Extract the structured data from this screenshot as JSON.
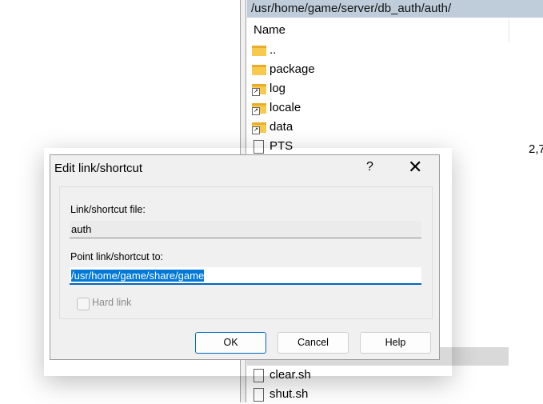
{
  "panel": {
    "path": "/usr/home/game/server/db_auth/auth/",
    "column_name": "Name",
    "items": [
      {
        "name": "..",
        "type": "parent"
      },
      {
        "name": "package",
        "type": "folder"
      },
      {
        "name": "log",
        "type": "folder-link"
      },
      {
        "name": "locale",
        "type": "folder-link"
      },
      {
        "name": "data",
        "type": "folder-link"
      },
      {
        "name": "PTS",
        "type": "file",
        "size": "2,7"
      },
      {
        "name": "clear.sh",
        "type": "file"
      },
      {
        "name": "shut.sh",
        "type": "file"
      }
    ]
  },
  "dialog": {
    "title": "Edit link/shortcut",
    "help_glyph": "?",
    "close_glyph": "✕",
    "file_label": "Link/shortcut file:",
    "file_value": "auth",
    "target_label": "Point link/shortcut to:",
    "target_value": "/usr/home/game/share/game",
    "hard_link_label": "Hard link",
    "hard_link_checked": false,
    "ok": "OK",
    "cancel": "Cancel",
    "help": "Help"
  }
}
